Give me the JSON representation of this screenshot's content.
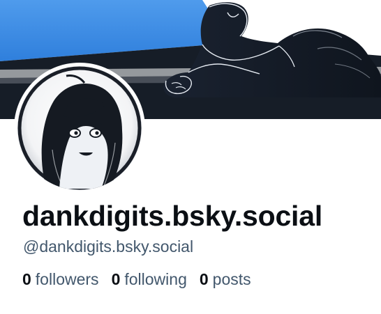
{
  "profile": {
    "display_name": "dankdigits.bsky.social",
    "handle": "@dankdigits.bsky.social"
  },
  "stats": {
    "followers": {
      "count": "0",
      "label": "followers"
    },
    "following": {
      "count": "0",
      "label": "following"
    },
    "posts": {
      "count": "0",
      "label": "posts"
    }
  },
  "colors": {
    "banner_sky_blue": "#3d8fe6",
    "banner_dark": "#161d27",
    "figure_fill": "#1c2532",
    "text_primary": "#0b0f14",
    "text_secondary": "#42576c"
  }
}
